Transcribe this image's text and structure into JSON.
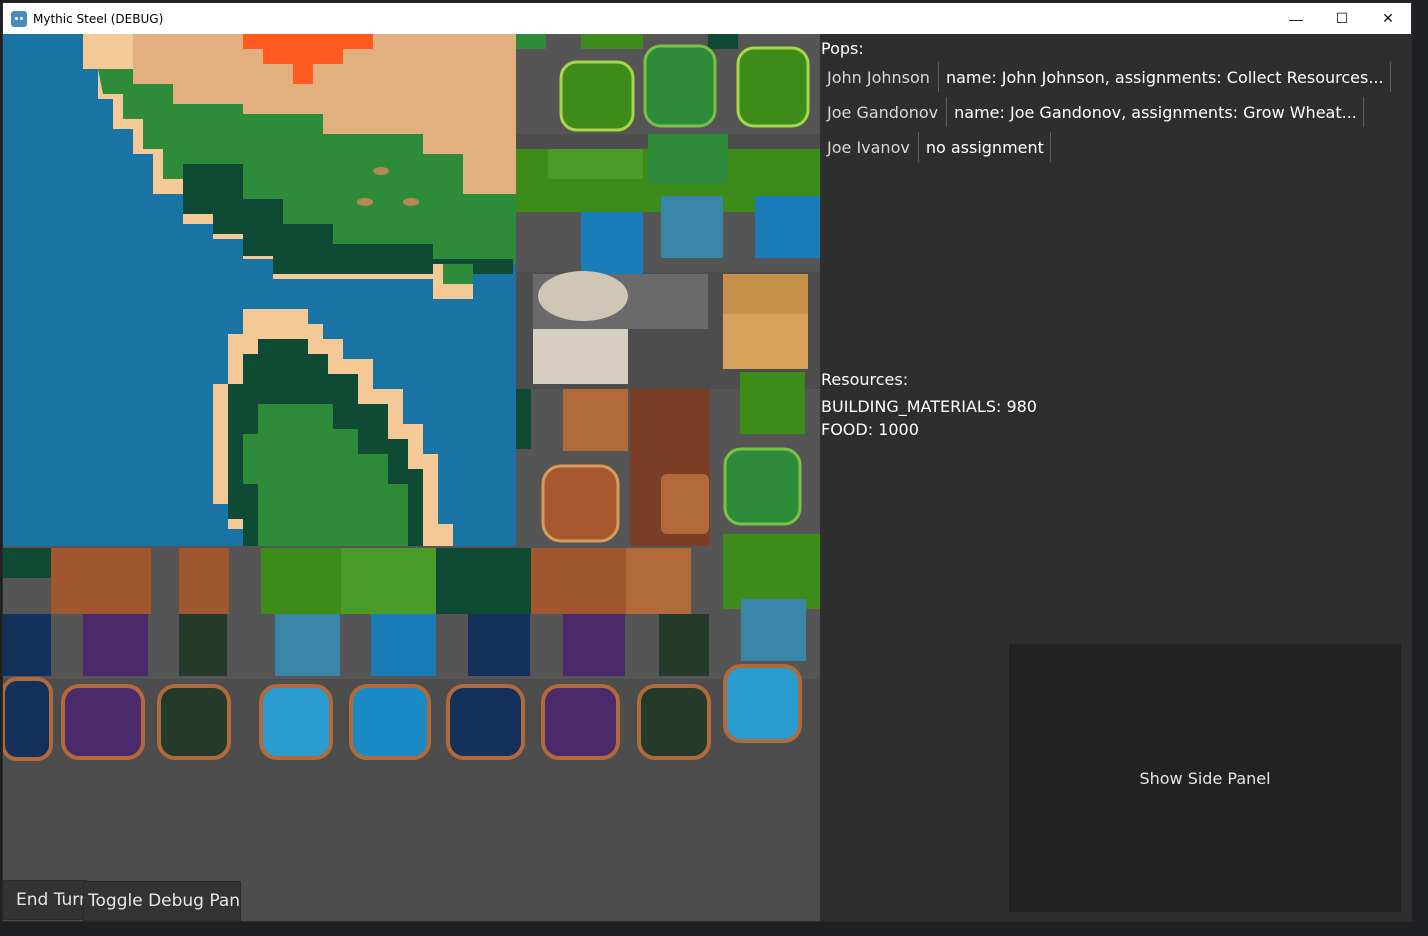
{
  "window": {
    "title": "Mythic Steel (DEBUG)",
    "controls": {
      "minimize": "—",
      "maximize": "☐",
      "close": "✕"
    }
  },
  "side_panel": {
    "pops_title": "Pops:",
    "pops": [
      {
        "name": "John Johnson",
        "description": "name: John Johnson, assignments: Collect Resources..."
      },
      {
        "name": "Joe Gandonov",
        "description": "name: Joe Gandonov, assignments: Grow Wheat..."
      },
      {
        "name": "Joe Ivanov",
        "description": "no assignment"
      }
    ],
    "resources_title": "Resources:",
    "resources": [
      "BUILDING_MATERIALS: 980",
      "FOOD: 1000"
    ]
  },
  "show_side_panel_label": "Show Side Panel",
  "buttons": {
    "end_turn": "End Turn",
    "toggle_debug": "Toggle Debug Panel"
  },
  "colors": {
    "water": "#1a73a5",
    "grass": "#2e8b3a",
    "dark_forest": "#0e4a34",
    "sand": "#f4c996",
    "dirt": "#e2b07e",
    "lava": "#ff5a1f",
    "map_background": "#4d4d4d",
    "panel": "#2a2a2a"
  }
}
